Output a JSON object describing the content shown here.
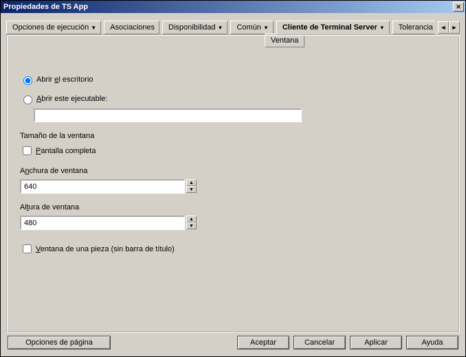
{
  "title": "Propiedades de TS App",
  "tabs": {
    "ejecucion": "Opciones de ejecución",
    "asociaciones": "Asociaciones",
    "disponibilidad": "Disponibilidad",
    "comun": "Común",
    "terminal": "Cliente de Terminal Server",
    "tolerancia": "Tolerancia"
  },
  "dropdown_item": "Ventana",
  "radio": {
    "open_desktop": "Abrir el escritorio",
    "open_exec": "Abrir este ejecutable:"
  },
  "exec_value": "",
  "window_size_label": "Tamaño de la ventana",
  "fullscreen_label": "Pantalla completa",
  "width_label": "Anchura de ventana",
  "width_value": "640",
  "height_label": "Altura de ventana",
  "height_value": "480",
  "seamless_label": "Ventana de una pieza (sin barra de título)",
  "buttons": {
    "page_opts": "Opciones de página",
    "ok": "Aceptar",
    "cancel": "Cancelar",
    "apply": "Aplicar",
    "help": "Ayuda"
  }
}
